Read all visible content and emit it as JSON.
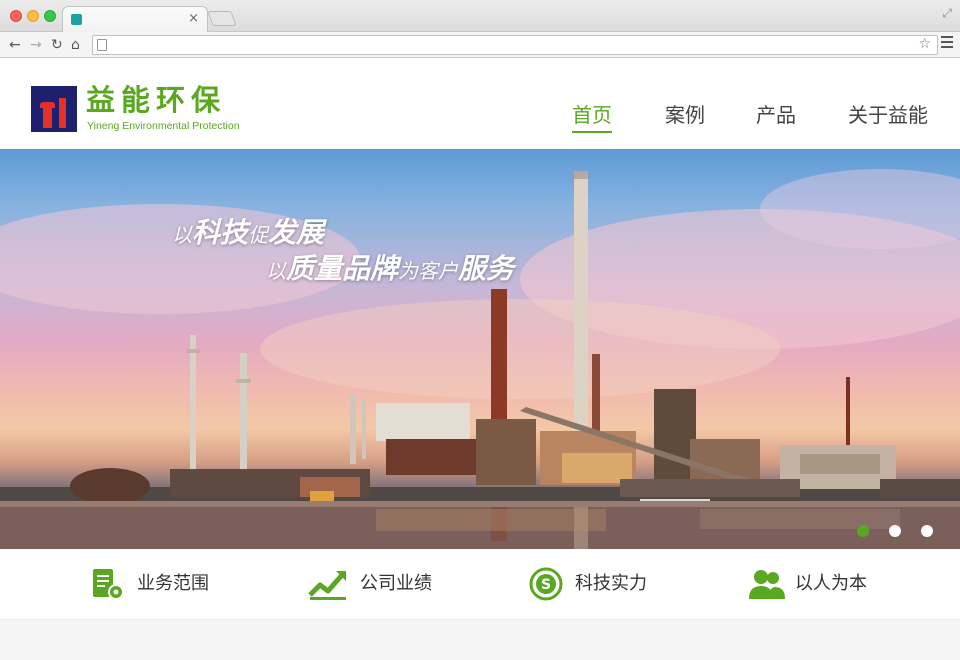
{
  "browser": {
    "tab_close": "×",
    "url": "",
    "icons": [
      "close-icon",
      "back-icon",
      "forward-icon",
      "reload-icon",
      "home-icon",
      "star-icon",
      "menu-icon"
    ]
  },
  "site": {
    "logo_cn": "益能环保",
    "logo_en": "Yineng Environmental Protection",
    "nav": [
      {
        "label": "首页",
        "active": true
      },
      {
        "label": "案例",
        "active": false
      },
      {
        "label": "产品",
        "active": false
      },
      {
        "label": "关于益能",
        "active": false
      }
    ]
  },
  "banner": {
    "slogan_line1": {
      "p1": "以",
      "p2": "科技",
      "p3": "促",
      "p4": "发展"
    },
    "slogan_line2": {
      "p1": "以",
      "p2": "质量品牌",
      "p3": "为客户",
      "p4": "服务"
    },
    "slides_total": 3,
    "active_slide": 1
  },
  "features": [
    {
      "label": "业务范围",
      "icon": "document-gear-icon"
    },
    {
      "label": "公司业绩",
      "icon": "growth-chart-icon"
    },
    {
      "label": "科技实力",
      "icon": "technology-badge-icon"
    },
    {
      "label": "以人为本",
      "icon": "people-icon"
    }
  ],
  "colors": {
    "brand_green": "#5aa722",
    "logo_navy": "#1e1f6e",
    "logo_red": "#e53125"
  }
}
